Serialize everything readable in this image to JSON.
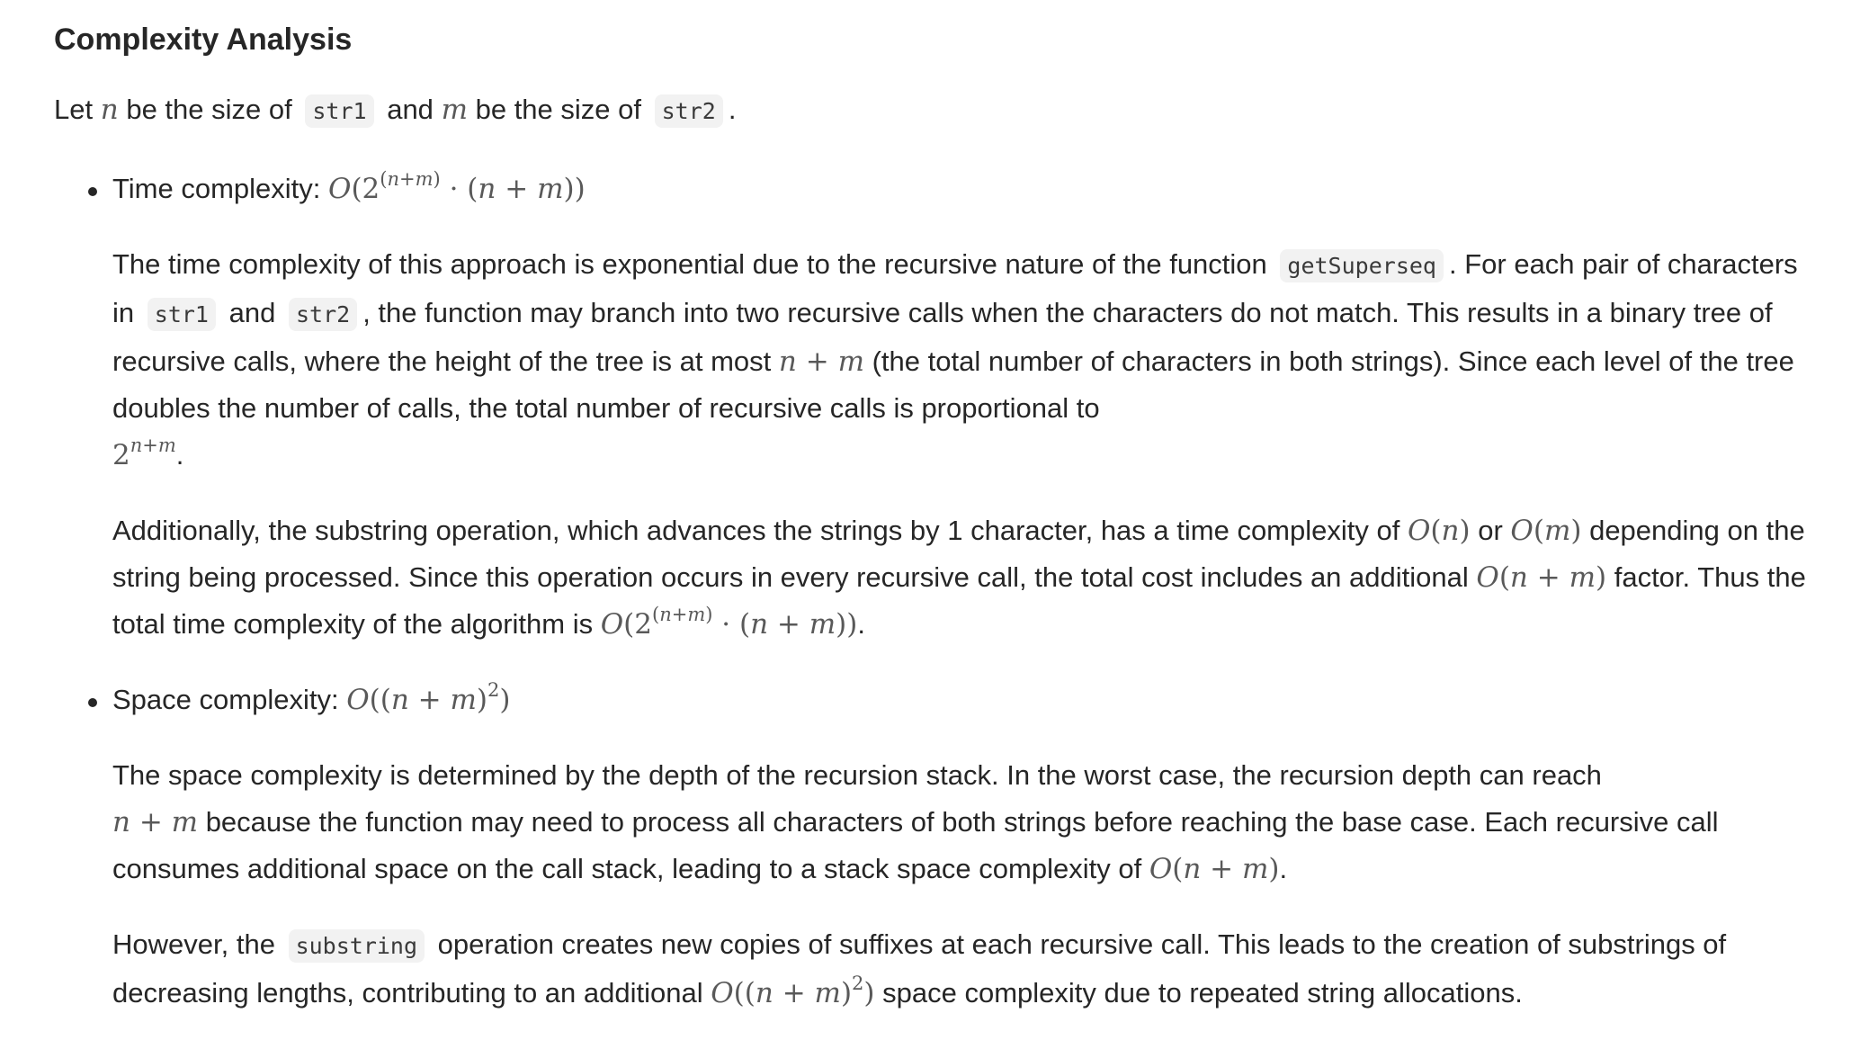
{
  "heading": "Complexity Analysis",
  "intro": {
    "let": "Let",
    "var_n": "n",
    "be_size_of_1": "be the size of",
    "str1": "str1",
    "and": "and",
    "var_m": "m",
    "be_size_of_2": "be the size of",
    "str2": "str2",
    "period": "."
  },
  "time": {
    "title": "Time complexity:",
    "formula": "O(2^(n+m) · (n+m))",
    "p1": {
      "t1": "The time complexity of this approach is exponential due to the recursive nature of the function",
      "code_fn": "getSuperseq",
      "t2": ". For each pair of characters in",
      "code_str1": "str1",
      "t3": "and",
      "code_str2": "str2",
      "t4": ", the function may branch into two recursive calls when the characters do not match. This results in a binary tree of recursive calls, where the height of the tree is at most",
      "math_height": "n+m",
      "t5": "(the total number of characters in both strings). Since each level of the tree doubles the number of calls, the total number of recursive calls is proportional to",
      "math_calls": "2^(n+m)",
      "t6": "."
    },
    "p2": {
      "t1": "Additionally, the substring operation, which advances the strings by 1 character, has a time complexity of",
      "math_on": "O(n)",
      "t2": "or",
      "math_om": "O(m)",
      "t3": "depending on the string being processed. Since this operation occurs in every recursive call, the total cost includes an additional",
      "math_factor": "O(n+m)",
      "t4": "factor. Thus the total time complexity of the algorithm is",
      "math_total": "O(2^(n+m) · (n+m))",
      "t5": "."
    }
  },
  "space": {
    "title": "Space complexity:",
    "formula": "O((n+m)^2)",
    "p1": {
      "t1": "The space complexity is determined by the depth of the recursion stack. In the worst case, the recursion depth can reach",
      "math_depth": "n+m",
      "t2": "because the function may need to process all characters of both strings before reaching the base case. Each recursive call consumes additional space on the call stack, leading to a stack space complexity of",
      "math_stack": "O(n+m)",
      "t3": "."
    },
    "p2": {
      "t1": "However, the",
      "code_substring": "substring",
      "t2": "operation creates new copies of suffixes at each recursive call. This leads to the creation of substrings of decreasing lengths, contributing to an additional",
      "math_add": "O((n+m)^2)",
      "t3": "space complexity due to repeated string allocations."
    }
  }
}
